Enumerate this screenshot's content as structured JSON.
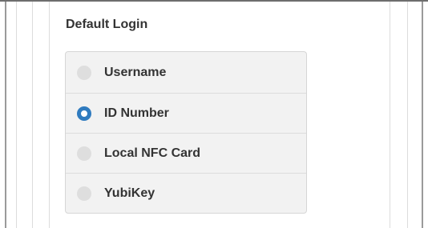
{
  "section": {
    "title": "Default Login"
  },
  "login_options": [
    {
      "label": "Username",
      "selected": false
    },
    {
      "label": "ID Number",
      "selected": true
    },
    {
      "label": "Local NFC Card",
      "selected": false
    },
    {
      "label": "YubiKey",
      "selected": false
    }
  ],
  "colors": {
    "selected_radio": "#2f7bbf",
    "unselected_radio": "#dedede",
    "list_background": "#f2f2f2",
    "text": "#333333"
  }
}
